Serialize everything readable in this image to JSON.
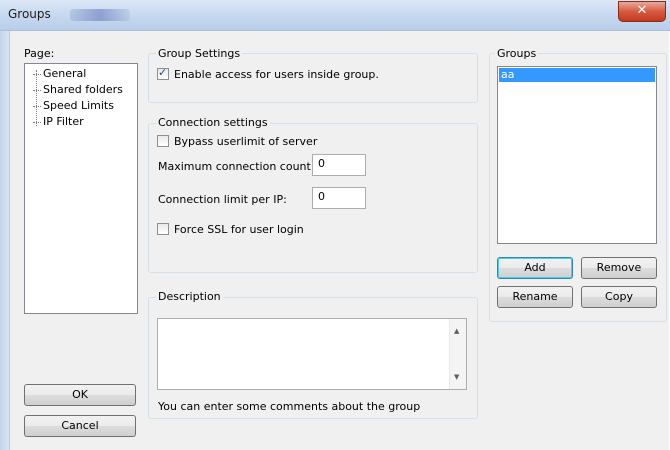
{
  "window": {
    "title": "Groups",
    "close_glyph": "✕"
  },
  "page_panel": {
    "label": "Page:",
    "items": [
      "General",
      "Shared folders",
      "Speed Limits",
      "IP Filter"
    ]
  },
  "group_settings": {
    "title": "Group Settings",
    "enable_access": {
      "label": "Enable access for users inside group.",
      "checked": true
    }
  },
  "connection_settings": {
    "title": "Connection settings",
    "bypass": {
      "label": "Bypass userlimit of server",
      "checked": false
    },
    "max_connections": {
      "label": "Maximum connection count:",
      "value": "0"
    },
    "limit_per_ip": {
      "label": "Connection limit per IP:",
      "value": "0"
    },
    "force_ssl": {
      "label": "Force SSL for user login",
      "checked": false
    }
  },
  "description": {
    "title": "Description",
    "text": "",
    "hint": "You can enter some comments about the group"
  },
  "groups": {
    "title": "Groups",
    "items": [
      "aa"
    ],
    "selected": "aa",
    "add_label": "Add",
    "remove_label": "Remove",
    "rename_label": "Rename",
    "copy_label": "Copy"
  },
  "footer": {
    "ok_label": "OK",
    "cancel_label": "Cancel"
  },
  "colors": {
    "selection": "#3399ff",
    "titlebar": "#c9daf0",
    "close": "#c7432a"
  },
  "icons": {
    "close": "close-icon",
    "check": "checkmark-icon",
    "scroll_up": "scroll-up-arrow-icon",
    "scroll_down": "scroll-down-arrow-icon"
  }
}
